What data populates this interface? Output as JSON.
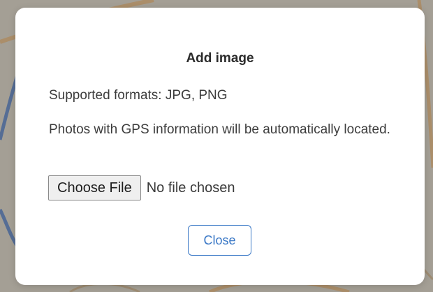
{
  "dialog": {
    "title": "Add image",
    "supported_formats": "Supported formats: JPG, PNG",
    "gps_note": "Photos with GPS information will be automatically located.",
    "file_button_label": "Choose File",
    "file_status": "No file chosen",
    "close_label": "Close"
  },
  "colors": {
    "accent": "#3a78c6",
    "modal_background": "#ffffff",
    "backdrop": "#8a8478"
  }
}
